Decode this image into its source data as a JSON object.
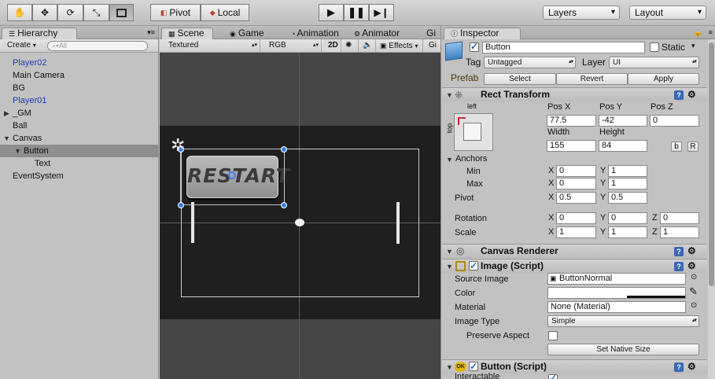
{
  "toolbar": {
    "pivot": "Pivot",
    "local": "Local",
    "layers": "Layers",
    "layout": "Layout"
  },
  "hierarchy": {
    "tab": "Hierarchy",
    "create": "Create",
    "search_placeholder": "All",
    "items": [
      {
        "label": "Player02"
      },
      {
        "label": "Main Camera"
      },
      {
        "label": "BG"
      },
      {
        "label": "Player01"
      },
      {
        "label": "_GM"
      },
      {
        "label": "Ball"
      },
      {
        "label": "Canvas"
      },
      {
        "label": "Button"
      },
      {
        "label": "Text"
      },
      {
        "label": "EventSystem"
      }
    ]
  },
  "scene": {
    "tabs": [
      "Scene",
      "Game",
      "Animation",
      "Animator",
      "Gi"
    ],
    "shading": "Textured",
    "render": "RGB",
    "mode2d": "2D",
    "effects": "Effects",
    "gizmos": "Gi",
    "button_text": "RESTART"
  },
  "inspector": {
    "tab": "Inspector",
    "name": "Button",
    "static": "Static",
    "tag_label": "Tag",
    "tag": "Untagged",
    "layer_label": "Layer",
    "layer": "UI",
    "prefab_label": "Prefab",
    "select": "Select",
    "revert": "Revert",
    "apply": "Apply",
    "rect_transform": "Rect Transform",
    "anchor_h": "left",
    "anchor_v": "top",
    "pos_x_label": "Pos X",
    "pos_y_label": "Pos Y",
    "pos_z_label": "Pos Z",
    "pos_x": "77.5",
    "pos_y": "-42",
    "pos_z": "0",
    "width_label": "Width",
    "height_label": "Height",
    "width": "155",
    "height": "84",
    "b_btn": "b",
    "r_btn": "R",
    "anchors": "Anchors",
    "min": "Min",
    "max": "Max",
    "pivot": "Pivot",
    "rotation": "Rotation",
    "scale": "Scale",
    "x": "X",
    "y": "Y",
    "z": "Z",
    "min_x": "0",
    "min_y": "1",
    "max_x": "0",
    "max_y": "1",
    "pivot_x": "0.5",
    "pivot_y": "0.5",
    "rot_x": "0",
    "rot_y": "0",
    "rot_z": "0",
    "scale_x": "1",
    "scale_y": "1",
    "scale_z": "1",
    "canvas_renderer": "Canvas Renderer",
    "image_script": "Image (Script)",
    "source_image_label": "Source Image",
    "source_image": "ButtonNormal",
    "color_label": "Color",
    "material_label": "Material",
    "material": "None (Material)",
    "image_type_label": "Image Type",
    "image_type": "Simple",
    "preserve_aspect": "Preserve Aspect",
    "set_native_size": "Set Native Size",
    "button_script": "Button (Script)",
    "interactable": "Interactable"
  }
}
